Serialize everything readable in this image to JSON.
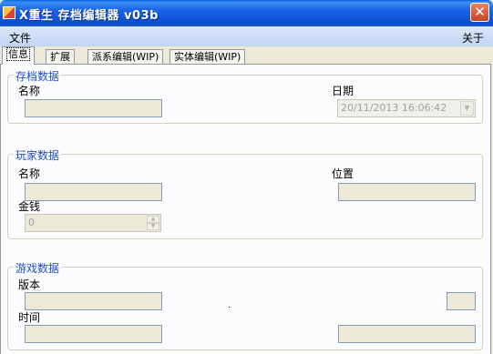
{
  "window": {
    "title": "X重生  存档编辑器  v03b",
    "close_glyph": "✕"
  },
  "menu": {
    "file": "文件",
    "about": "关于"
  },
  "tabs": [
    "信息",
    "扩展",
    "派系编辑(WIP)",
    "实体编辑(WIP)"
  ],
  "save_group": {
    "title": "存档数据",
    "name_label": "名称",
    "name_value": "",
    "date_label": "日期",
    "date_value": "20/11/2013 16:06:42"
  },
  "player_group": {
    "title": "玩家数据",
    "name_label": "名称",
    "name_value": "",
    "position_label": "位置",
    "position_value": "",
    "money_label": "金钱",
    "money_value": "0"
  },
  "game_group": {
    "title": "游戏数据",
    "version_label": "版本",
    "version_value": "",
    "time_label": "时间",
    "time_value": ""
  },
  "icons": {
    "dropdown": "▼",
    "spin_up": "▲",
    "spin_down": "▼"
  }
}
